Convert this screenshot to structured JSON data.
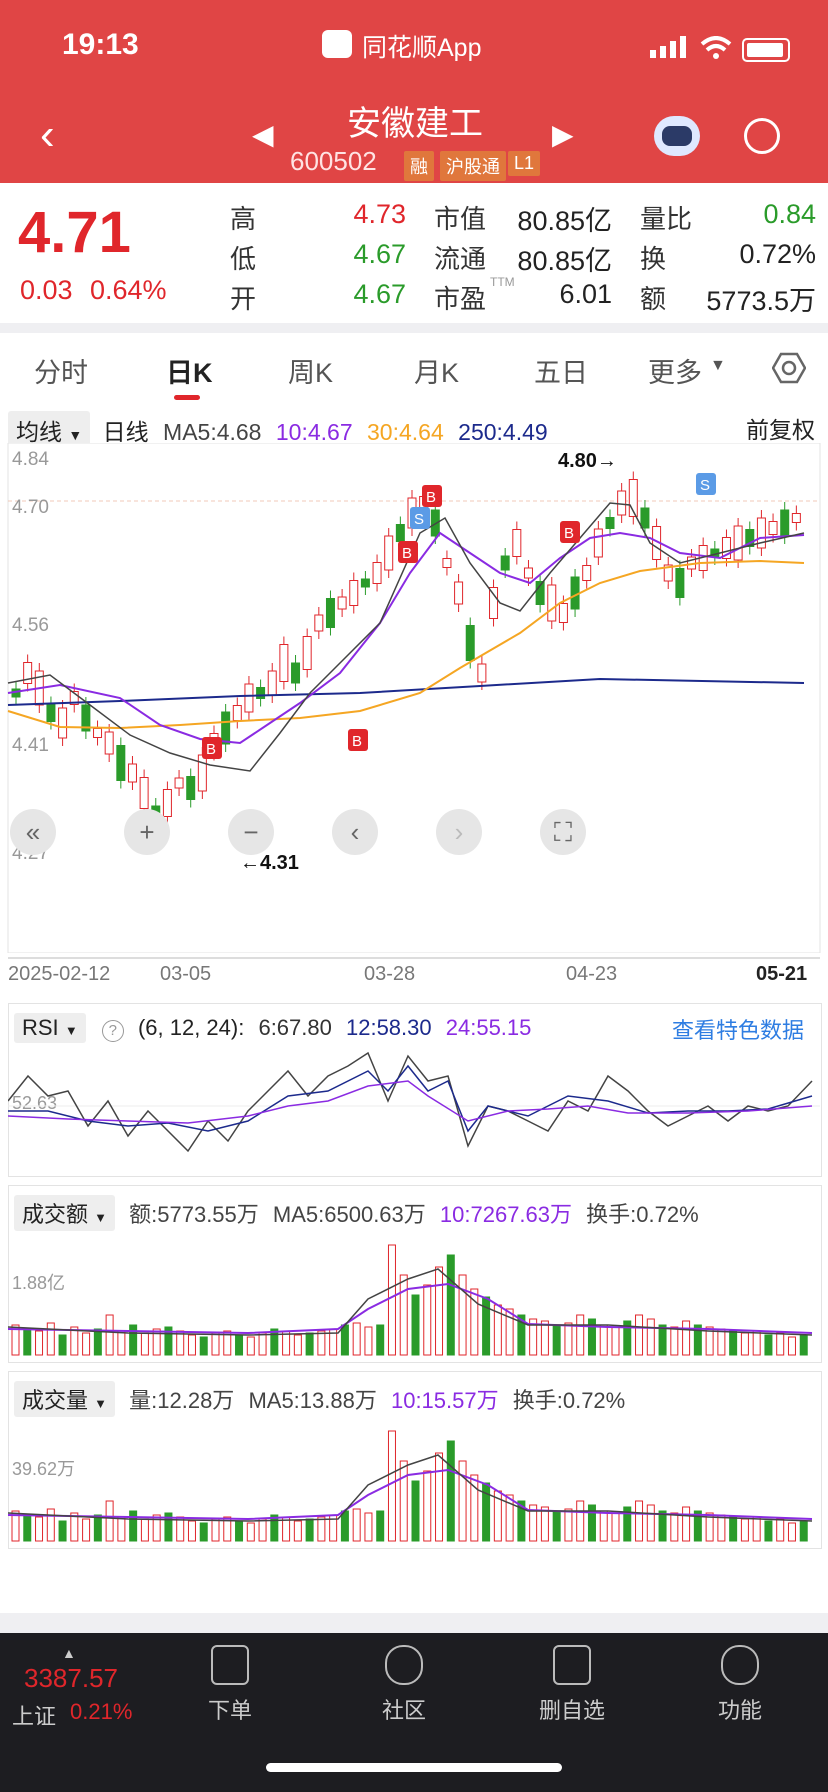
{
  "status_bar": {
    "time": "19:13",
    "app_label": "同花顺App"
  },
  "header": {
    "stock_name": "安徽建工",
    "stock_code": "600502",
    "badges": [
      "融",
      "沪股通",
      "L1"
    ]
  },
  "quote": {
    "price": "4.71",
    "change": "0.03",
    "change_pct": "0.64%",
    "high_label": "高",
    "high": "4.73",
    "low_label": "低",
    "low": "4.67",
    "open_label": "开",
    "open": "4.67",
    "mktcap_label": "市值",
    "mktcap": "80.85亿",
    "float_label": "流通",
    "float": "80.85亿",
    "pe_label": "市盈",
    "pe_sup": "TTM",
    "pe": "6.01",
    "volratio_label": "量比",
    "volratio": "0.84",
    "turnover_label": "换",
    "turnover": "0.72%",
    "amount_label": "额",
    "amount": "5773.5万",
    "colors": {
      "up": "#e0262b",
      "down": "#2a9b2a"
    }
  },
  "tabs": [
    "分时",
    "日K",
    "周K",
    "月K",
    "五日",
    "更多"
  ],
  "active_tab": "日K",
  "ma_bar": {
    "selector": "均线",
    "period": "日线",
    "ma5": "MA5:4.68",
    "ma10": "10:4.67",
    "ma30": "30:4.64",
    "ma250": "250:4.49",
    "adjust": "前复权"
  },
  "kline_axis": {
    "y_labels": [
      "4.84",
      "4.70",
      "4.56",
      "4.41",
      "4.27"
    ],
    "dates": [
      "2025-02-12",
      "03-05",
      "03-28",
      "04-23",
      "05-21"
    ],
    "high_mark": "4.80→",
    "low_mark": "←4.31"
  },
  "rsi": {
    "selector": "RSI",
    "params": "(6, 12, 24):",
    "rsi6": "6:67.80",
    "rsi12": "12:58.30",
    "rsi24": "24:55.15",
    "link": "查看特色数据",
    "ylabel": "52.63"
  },
  "amount_panel": {
    "selector": "成交额",
    "value": "额:5773.55万",
    "ma5": "MA5:6500.63万",
    "ma10": "10:7267.63万",
    "turnover": "换手:0.72%",
    "ylabel": "1.88亿"
  },
  "volume_panel": {
    "selector": "成交量",
    "value": "量:12.28万",
    "ma5": "MA5:13.88万",
    "ma10": "10:15.57万",
    "turnover": "换手:0.72%",
    "ylabel": "39.62万"
  },
  "bottom": {
    "index_value": "3387.57",
    "index_name": "上证",
    "index_pct": "0.21%",
    "nav": [
      "下单",
      "社区",
      "删自选",
      "功能"
    ]
  },
  "chart_data": {
    "type": "candlestick",
    "x": [
      "2025-02-12",
      "2025-03-05",
      "2025-03-28",
      "2025-04-23",
      "2025-05-21"
    ],
    "ylim": [
      4.27,
      4.84
    ],
    "annotations": {
      "high": 4.8,
      "low": 4.31
    }
  }
}
